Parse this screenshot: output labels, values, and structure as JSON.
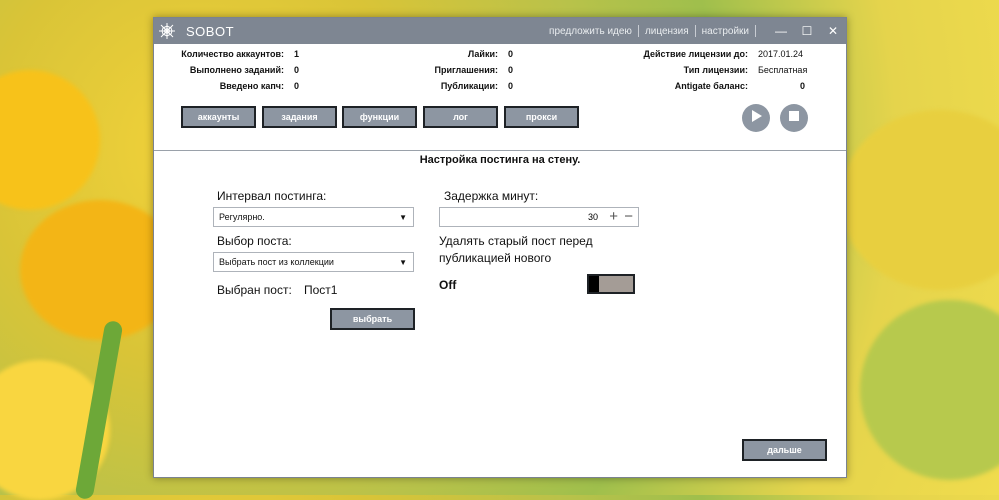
{
  "window": {
    "title": "SOBOT",
    "links": [
      "предложить идею",
      "лицензия",
      "настройки"
    ],
    "controls": [
      "—",
      "☐",
      "✕"
    ]
  },
  "stats": {
    "accounts_label": "Количество аккаунтов:",
    "accounts_value": "1",
    "tasks_label": "Выполнено заданий:",
    "tasks_value": "0",
    "captcha_label": "Введено капч:",
    "captcha_value": "0",
    "likes_label": "Лайки:",
    "likes_value": "0",
    "invites_label": "Приглашения:",
    "invites_value": "0",
    "posts_label": "Публикации:",
    "posts_value": "0",
    "license_until_label": "Действие лицензии до:",
    "license_until_value": "2017.01.24",
    "license_type_label": "Тип лицензии:",
    "license_type_value": "Бесплатная",
    "antigate_label": "Antigate баланс:",
    "antigate_value": "0"
  },
  "tabs": [
    "аккаунты",
    "задания",
    "функции",
    "лог",
    "прокси"
  ],
  "main": {
    "title": "Настройка постинга на стену.",
    "interval_label": "Интервал постинга:",
    "interval_value": "Регулярно.",
    "post_select_label": "Выбор поста:",
    "post_select_value": "Выбрать пост из коллекции",
    "selected_post_label": "Выбран пост:",
    "selected_post_value": "Пост1",
    "choose_button": "выбрать",
    "delay_label": "Задержка минут:",
    "delay_value": "30",
    "delete_old_label_line1": "Удалять старый пост перед",
    "delete_old_label_line2": "публикацией нового",
    "toggle_state": "Off",
    "next_button": "дальше"
  },
  "colors": {
    "titlebar": "#7e8692",
    "button": "#8d96a2",
    "button_border": "#1e2226"
  }
}
